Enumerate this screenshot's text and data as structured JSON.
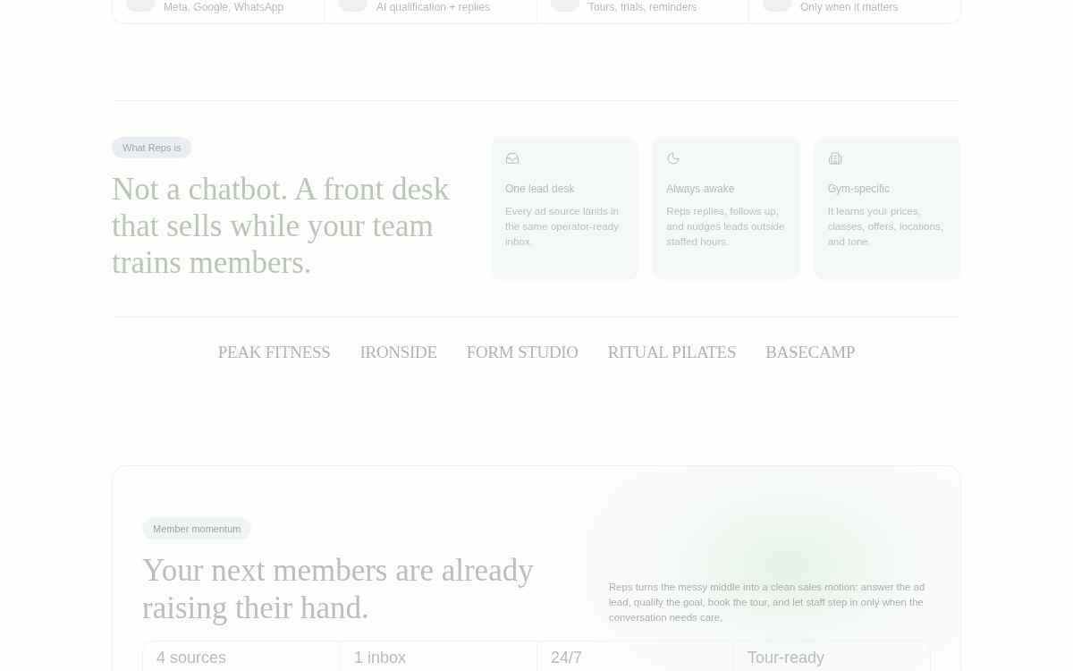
{
  "features_strip": {
    "items": [
      {
        "text": "Meta, Google, WhatsApp"
      },
      {
        "text": "AI qualification + replies"
      },
      {
        "text": "Tours, trials, reminders"
      },
      {
        "text": "Only when it matters"
      }
    ]
  },
  "about": {
    "badge": "What Reps is",
    "heading": "Not a chatbot. A front desk that sells while your team trains members.",
    "cards": [
      {
        "title": "One lead desk",
        "body": "Every ad source lands in the same operator-ready inbox."
      },
      {
        "title": "Always awake",
        "body": "Reps replies, follows up, and nudges leads outside staffed hours."
      },
      {
        "title": "Gym-specific",
        "body": "It learns your prices, classes, offers, locations, and tone."
      }
    ]
  },
  "logos": [
    "PEAK FITNESS",
    "IRONSIDE",
    "FORM STUDIO",
    "RITUAL PILATES",
    "BASECAMP"
  ],
  "cta": {
    "badge": "Member momentum",
    "heading": "Your next members are already raising their hand.",
    "body": "Reps turns the messy middle into a clean sales motion: answer the ad lead, qualify the goal, book the tour, and let staff step in only when the conversation needs care.",
    "stats": [
      "4 sources",
      "1 inbox",
      "24/7",
      "Tour-ready"
    ]
  }
}
